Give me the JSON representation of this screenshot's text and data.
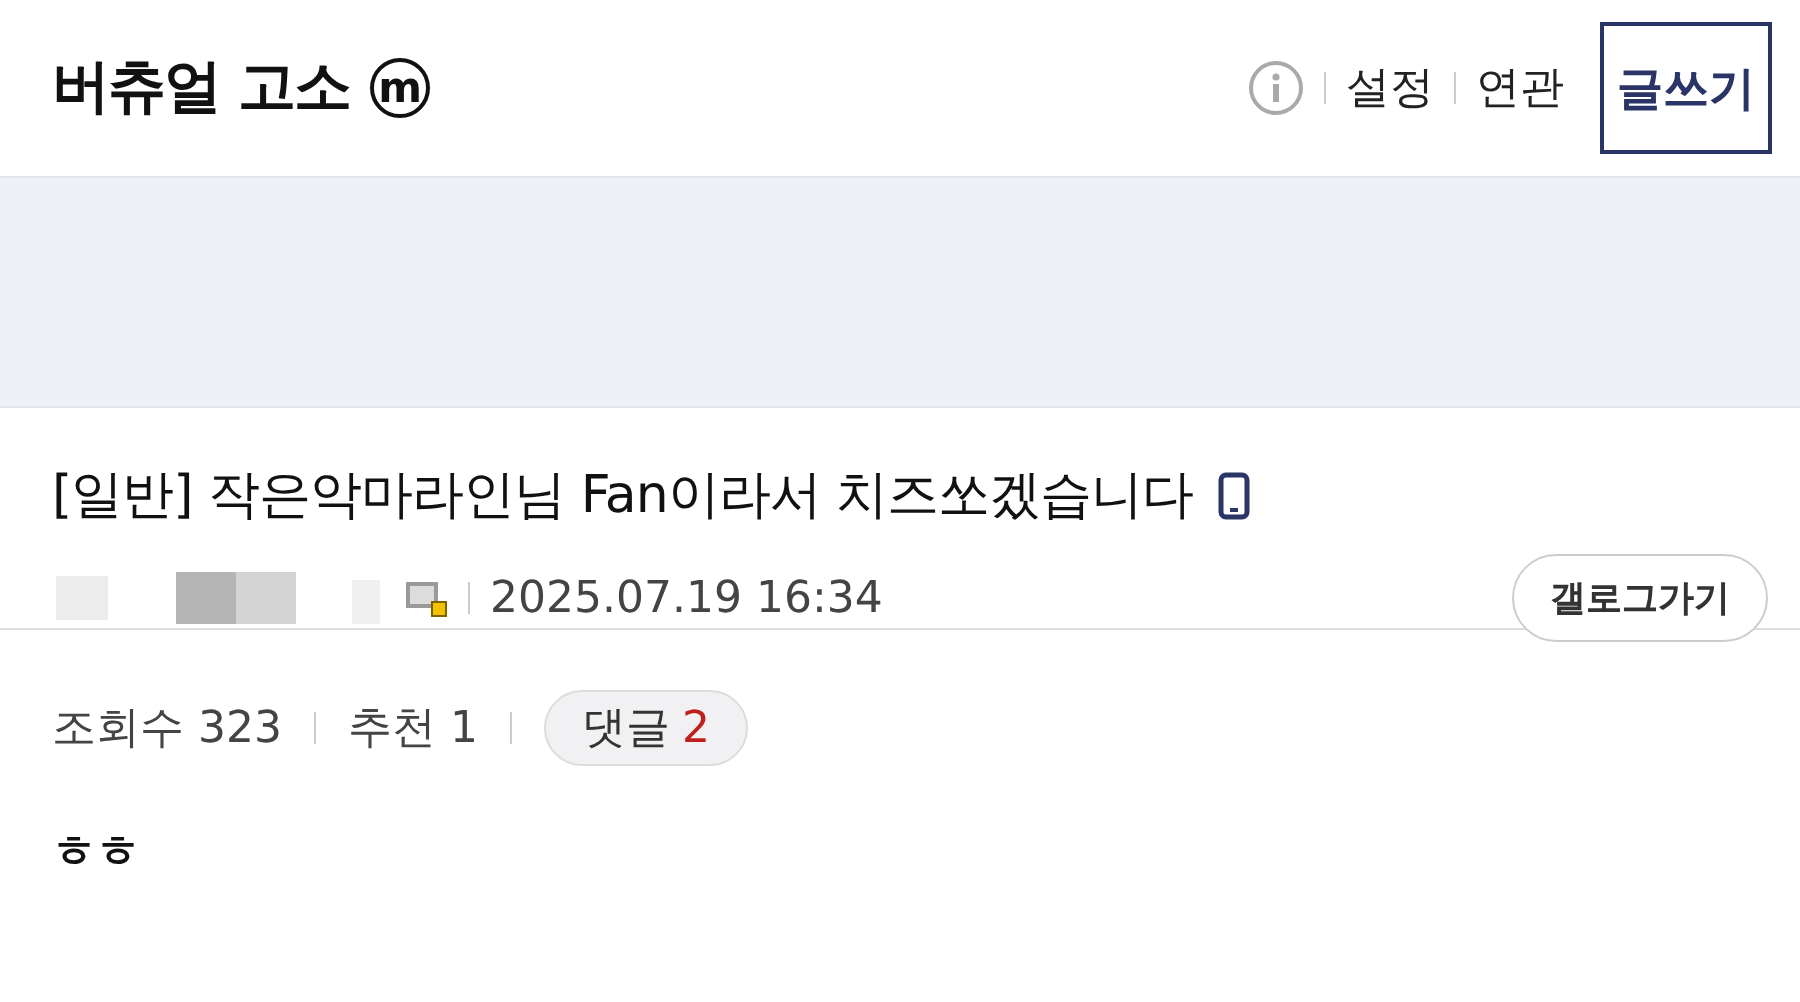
{
  "header": {
    "title": "버츄얼 고소",
    "badge": "m",
    "links": [
      "설정",
      "연관"
    ],
    "write_button": "글쓰기"
  },
  "post": {
    "title": "[일반] 작은악마라인님 Fan이라서 치즈쏘겠습니다",
    "date": "2025.07.19 16:34",
    "gallog_button": "갤로그가기"
  },
  "stats": {
    "views_label": "조회수",
    "views": "323",
    "recommend_label": "추천",
    "recommend": "1",
    "comments_label": "댓글",
    "comments": "2"
  },
  "body": "ㅎㅎ"
}
